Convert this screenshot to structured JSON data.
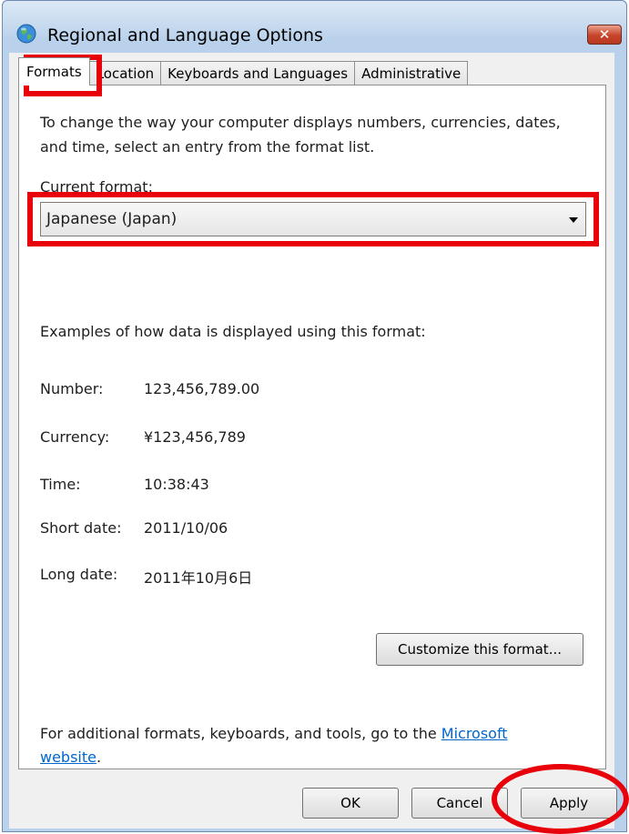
{
  "window": {
    "title": "Regional and Language Options",
    "close_label": "✕",
    "icon": "globe-icon"
  },
  "tabs": [
    {
      "label": "Formats",
      "active": true
    },
    {
      "label": "Location",
      "active": false
    },
    {
      "label": "Keyboards and Languages",
      "active": false
    },
    {
      "label": "Administrative",
      "active": false
    }
  ],
  "formats": {
    "intro_line1": "To change the way your computer displays numbers, currencies, dates,",
    "intro_line2": "and time, select an entry from the format list.",
    "current_format_label": "Current format:",
    "current_format_value": "Japanese (Japan)",
    "examples_heading": "Examples of how data is displayed using this format:",
    "examples": [
      {
        "label": "Number:",
        "value": "123,456,789.00"
      },
      {
        "label": "Currency:",
        "value": "¥123,456,789"
      },
      {
        "label": "Time:",
        "value": "10:38:43"
      },
      {
        "label": "Short date:",
        "value": "2011/10/06"
      },
      {
        "label": "Long date:",
        "value": "2011年10月6日"
      }
    ],
    "customize_button": "Customize this format...",
    "additional_text": "For additional formats, keyboards, and tools, go to the",
    "link_part1": "Microsoft",
    "link_part2": "website",
    "link_period": "."
  },
  "buttons": {
    "ok": "OK",
    "cancel": "Cancel",
    "apply": "Apply"
  },
  "annotation_color": "#e8000b"
}
